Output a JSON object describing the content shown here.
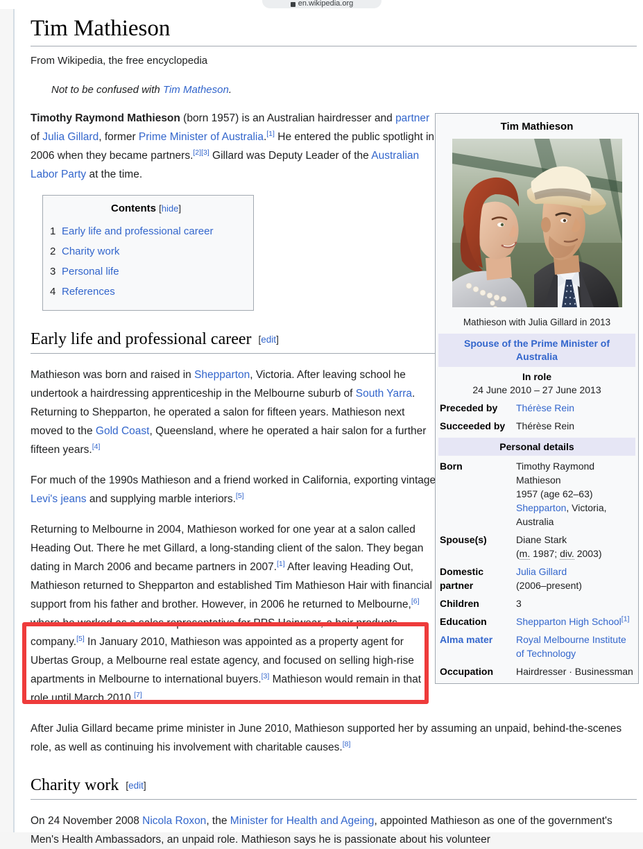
{
  "browser": {
    "url": "en.wikipedia.org",
    "lock_icon": "lock-icon"
  },
  "page": {
    "title": "Tim Mathieson",
    "tagline": "From Wikipedia, the free encyclopedia",
    "hatnote_prefix": "Not to be confused with ",
    "hatnote_link": "Tim Matheson",
    "hatnote_suffix": "."
  },
  "lead": {
    "p1_a": "Timothy Raymond Mathieson",
    "p1_b": " (born 1957) is an Australian hairdresser and ",
    "p1_link1": "partner",
    "p1_c": " of ",
    "p1_link2": "Julia Gillard",
    "p1_d": ", former ",
    "p1_link3": "Prime Minister of Australia",
    "p1_e": ".",
    "p1_ref1": "[1]",
    "p1_f": " He entered the public spotlight in 2006 when they became partners.",
    "p1_ref2": "[2]",
    "p1_ref3": "[3]",
    "p1_g": " Gillard was Deputy Leader of the ",
    "p1_link4": "Australian Labor Party",
    "p1_h": " at the time."
  },
  "toc": {
    "heading": "Contents",
    "toggle_open": "[",
    "toggle_label": "hide",
    "toggle_close": "]",
    "items": [
      {
        "num": "1",
        "label": "Early life and professional career"
      },
      {
        "num": "2",
        "label": "Charity work"
      },
      {
        "num": "3",
        "label": "Personal life"
      },
      {
        "num": "4",
        "label": "References"
      }
    ]
  },
  "sections": {
    "early_life": {
      "heading": "Early life and professional career",
      "edit_open": "[",
      "edit_label": "edit",
      "edit_close": "]"
    },
    "charity": {
      "heading": "Charity work",
      "edit_open": "[",
      "edit_label": "edit",
      "edit_close": "]"
    }
  },
  "paragraphs": {
    "p2_a": "Mathieson was born and raised in ",
    "p2_link1": "Shepparton",
    "p2_b": ", Victoria. After leaving school he undertook a hairdressing apprenticeship in the Melbourne suburb of ",
    "p2_link2": "South Yarra",
    "p2_c": ". Returning to Shepparton, he operated a salon for fifteen years. Mathieson next moved to the ",
    "p2_link3": "Gold Coast",
    "p2_d": ", Queensland, where he operated a hair salon for a further fifteen years.",
    "p2_ref": "[4]",
    "p3_a": "For much of the 1990s Mathieson and a friend worked in California, exporting vintage ",
    "p3_link1": "Levi's jeans",
    "p3_b": " and supplying marble interiors.",
    "p3_ref": "[5]",
    "p4_a": "Returning to Melbourne in 2004, Mathieson worked for one year at a salon called Heading Out. There he met Gillard, a long-standing client of the salon. They began dating in March 2006 and became partners in 2007.",
    "p4_ref1": "[1]",
    "p4_b": " After leaving Heading Out, Mathieson returned to Shepparton and established Tim Mathieson Hair with financial support from his father and brother. However, in 2006 he returned to Melbourne,",
    "p4_ref2": "[6]",
    "p4_c": " where he worked as a sales representative for PPS Hairwear, a hair products company.",
    "p4_ref3": "[5]",
    "p4_d": " In January 2010, Mathieson was appointed as a property agent for Ubertas Group, a Melbourne real estate agency, and focused on selling high-rise apartments in Melbourne to international buyers.",
    "p4_ref4": "[3]",
    "p4_e": " Mathieson would remain in that role until March 2010.",
    "p4_ref5": "[7]",
    "p5_a": "After Julia Gillard became prime minister in June 2010, Mathieson supported her by assuming an unpaid, behind-the-scenes role, as well as continuing his involvement with charitable causes.",
    "p5_ref": "[8]",
    "p6_a": "On 24 November 2008 ",
    "p6_link1": "Nicola Roxon",
    "p6_b": ", the ",
    "p6_link2": "Minister for Health and Ageing",
    "p6_c": ", appointed Mathieson as one of the government's Men's Health Ambassadors, an unpaid role. Mathieson says he is passionate about his volunteer"
  },
  "infobox": {
    "title": "Tim Mathieson",
    "photo_alt": "Mathieson with Julia Gillard photograph",
    "caption": "Mathieson with Julia Gillard in 2013",
    "office": "Spouse of the Prime Minister of Australia",
    "in_role_label": "In role",
    "in_role_dates": "24 June 2010 – 27 June 2013",
    "preceded_by_label": "Preceded by",
    "preceded_by_value": "Thérèse Rein",
    "succeeded_by_label": "Succeeded by",
    "succeeded_by_value": "Thérèse Rein",
    "personal_details": "Personal details",
    "born_label": "Born",
    "born_name": "Timothy Raymond Mathieson",
    "born_year": "1957 (age 62–63)",
    "born_place_link": "Shepparton",
    "born_place_rest": ", Victoria, Australia",
    "spouse_label": "Spouse(s)",
    "spouse_name": "Diane Stark",
    "spouse_m_abbr": "m.",
    "spouse_m_year": " 1987; ",
    "spouse_div_abbr": "div.",
    "spouse_div_year": " 2003)",
    "spouse_paren_open": "(",
    "domestic_label": "Domestic partner",
    "domestic_link": "Julia Gillard",
    "domestic_dates": "(2006–present)",
    "children_label": "Children",
    "children_value": "3",
    "education_label": "Education",
    "education_value": "Shepparton High School",
    "education_ref": "[1]",
    "alma_label": "Alma mater",
    "alma_value": "Royal Melbourne Institute of Technology",
    "occupation_label": "Occupation",
    "occupation_value": "Hairdresser · Businessman"
  },
  "annotation": {
    "highlight_color": "#ee3b3b",
    "highlight_target": "Ubertas Group property agent sentences"
  }
}
